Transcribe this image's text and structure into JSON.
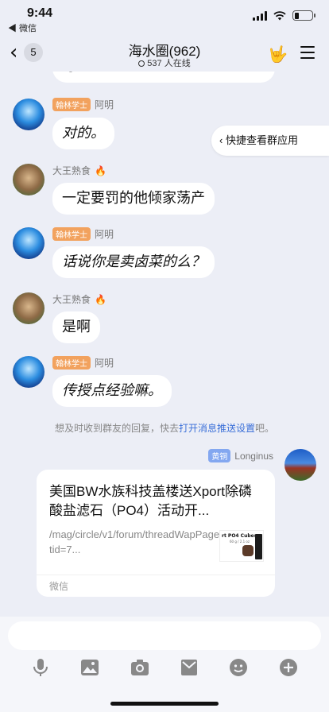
{
  "status_bar": {
    "time": "9:44",
    "back_app": "◀ 微信"
  },
  "nav": {
    "unread_count": "5",
    "title": "海水圈(962)",
    "online": "537 人在线"
  },
  "quick_app": "快捷查看群应用",
  "messages": [
    {
      "sender": "阿明",
      "badge": "翰林学士",
      "text": "对的。",
      "style": "hand"
    },
    {
      "sender": "大王熟食",
      "badge": "",
      "fire": "🔥",
      "text": "一定要罚的他倾家荡产",
      "style": "normal"
    },
    {
      "sender": "阿明",
      "badge": "翰林学士",
      "text": "话说你是卖卤菜的么？",
      "style": "hand"
    },
    {
      "sender": "大王熟食",
      "badge": "",
      "fire": "🔥",
      "text": "是啊",
      "style": "normal"
    },
    {
      "sender": "阿明",
      "badge": "翰林学士",
      "text": "传授点经验嘛。",
      "style": "hand"
    }
  ],
  "partial_bubble_text": "订",
  "tip": {
    "before": "想及时收到群友的回复，快去",
    "link": "打开消息推送设置",
    "after": "吧。"
  },
  "own_message": {
    "sender": "Longinus",
    "badge": "黄铜",
    "card_title": "美国BW水族科技盖楼送Xport除磷酸盐滤石（PO4）活动开...",
    "card_url": "/mag/circle/v1/forum/threadWapPage?tid=7...",
    "thumb_text": "rt PO4 Cubes",
    "thumb_subtext": "60 g / 2.1 oz",
    "card_footer": "微信"
  },
  "colors": {
    "badge_orange": "#f2a25e",
    "badge_blue": "#83a7f0",
    "link": "#3a6fd8",
    "background": "#eceef6"
  },
  "toolbar_icons": [
    "microphone-icon",
    "image-icon",
    "camera-icon",
    "envelope-icon",
    "emoji-icon",
    "plus-icon"
  ]
}
